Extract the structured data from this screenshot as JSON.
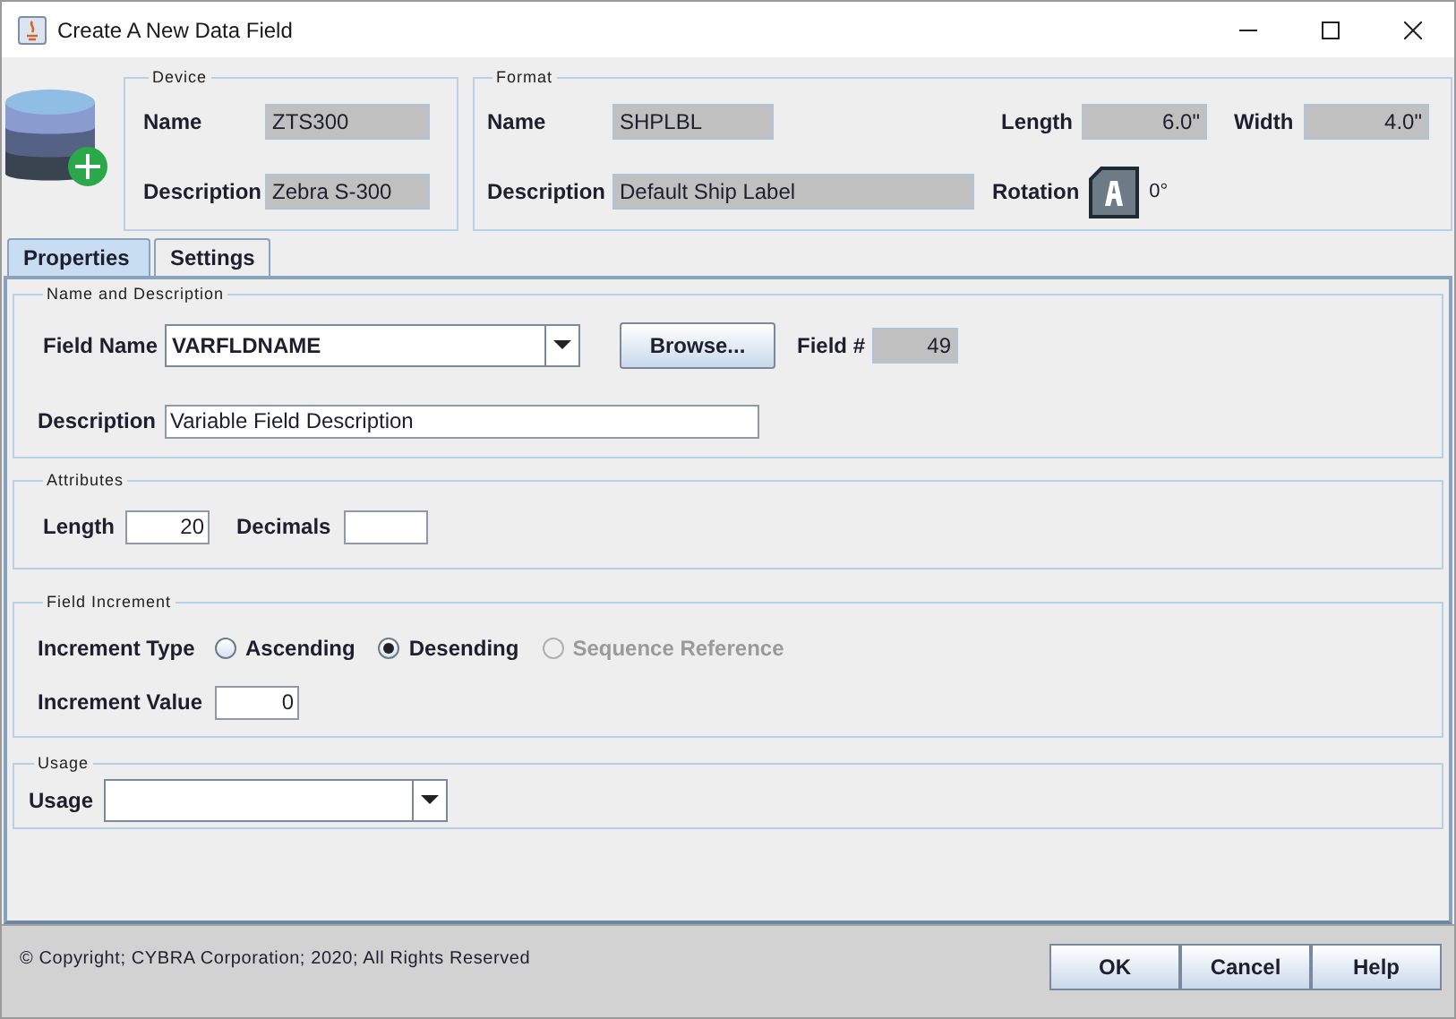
{
  "window": {
    "title": "Create A New Data Field"
  },
  "device": {
    "title": "Device",
    "name_label": "Name",
    "name": "ZTS300",
    "description_label": "Description",
    "description": "Zebra S-300"
  },
  "format": {
    "title": "Format",
    "name_label": "Name",
    "name": "SHPLBL",
    "description_label": "Description",
    "description": "Default Ship Label",
    "length_label": "Length",
    "length": "6.0\"",
    "width_label": "Width",
    "width": "4.0\"",
    "rotation_label": "Rotation",
    "rotation": "0°"
  },
  "tabs": [
    {
      "label": "Properties",
      "selected": true
    },
    {
      "label": "Settings",
      "selected": false
    }
  ],
  "name_and_description": {
    "title": "Name and Description",
    "field_name_label": "Field Name",
    "field_name": "VARFLDNAME",
    "browse_button": "Browse...",
    "field_number_label": "Field #",
    "field_number": "49",
    "description_label": "Description",
    "description": "Variable Field Description"
  },
  "attributes": {
    "title": "Attributes",
    "length_label": "Length",
    "length": "20",
    "decimals_label": "Decimals"
  },
  "field_increment": {
    "title": "Field Increment",
    "type_label": "Increment Type",
    "options": [
      {
        "label": "Ascending",
        "selected": false,
        "disabled": false
      },
      {
        "label": "Desending",
        "selected": true,
        "disabled": false
      },
      {
        "label": "Sequence Reference",
        "selected": false,
        "disabled": true
      }
    ],
    "value_label": "Increment Value",
    "value": "0"
  },
  "usage": {
    "title": "Usage",
    "usage_label": "Usage"
  },
  "footer": {
    "copyright": "© Copyright; CYBRA Corporation; 2020; All Rights Reserved",
    "buttons": [
      "OK",
      "Cancel",
      "Help"
    ]
  }
}
